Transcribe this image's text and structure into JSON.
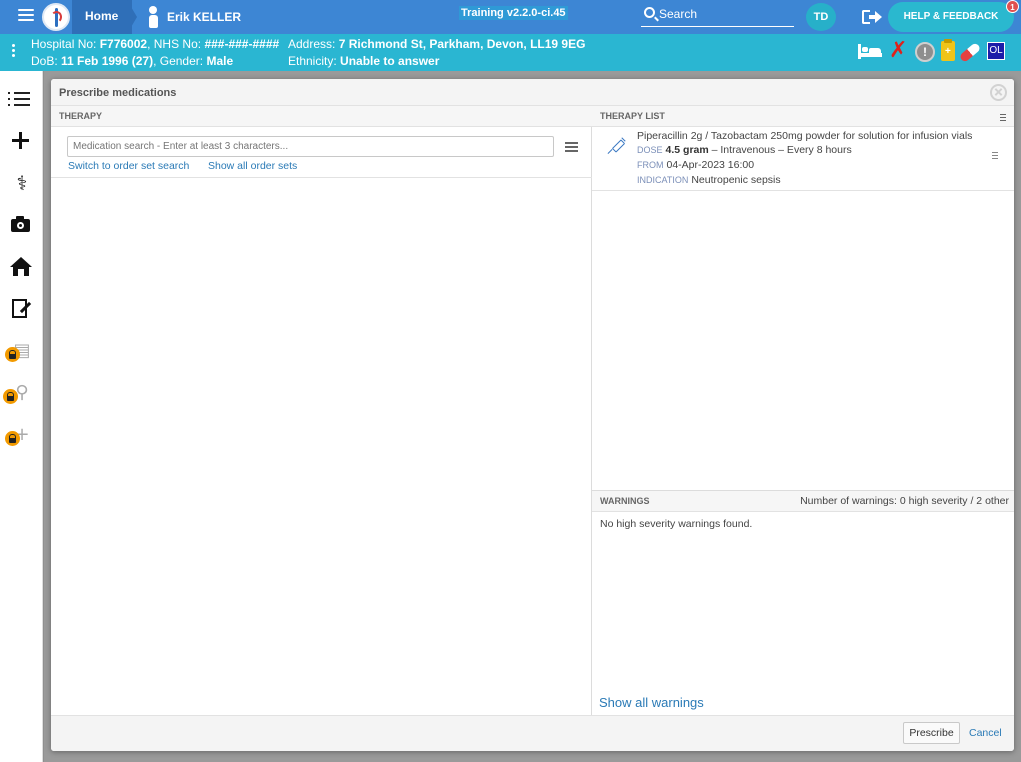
{
  "topbar": {
    "home_label": "Home",
    "patient_name": "Erik KELLER",
    "training_label": "Training v2.2.0-ci.45",
    "search_label": "Search",
    "avatar_initials": "TD",
    "help_label": "HELP & FEEDBACK",
    "help_badge": "1",
    "colors": {
      "bar": "#3d86d4",
      "help": "#2ab8cf"
    }
  },
  "banner": {
    "hospital_prefix": "Hospital No: ",
    "hospital_no": "F776002",
    "nhs_prefix": ", NHS No: ",
    "nhs_no": "###-###-####",
    "dob_prefix": "DoB: ",
    "dob": "11 Feb 1996 (27)",
    "gender_prefix": ", Gender: ",
    "gender": "Male",
    "address_prefix": "Address: ",
    "address": "7 Richmond St, Parkham, Devon, LL19 9EG",
    "ethnicity_prefix": "Ethnicity: ",
    "ethnicity": "Unable to answer",
    "ol_badge": "OL",
    "icons": [
      "bed-icon",
      "x-icon",
      "alert-icon",
      "clipboard-icon",
      "pill-icon",
      "ol-icon"
    ],
    "color": "#2ab6d2"
  },
  "sidebar": {
    "items": [
      {
        "icon": "list-icon",
        "locked": false
      },
      {
        "icon": "plus-icon",
        "locked": false
      },
      {
        "icon": "stethoscope-icon",
        "locked": false
      },
      {
        "icon": "camera-icon",
        "locked": false
      },
      {
        "icon": "home-icon",
        "locked": false
      },
      {
        "icon": "document-edit-icon",
        "locked": false
      },
      {
        "icon": "clipboard-icon",
        "locked": true
      },
      {
        "icon": "walking-icon",
        "locked": true
      },
      {
        "icon": "add-icon",
        "locked": true
      }
    ]
  },
  "modal": {
    "title": "Prescribe medications",
    "therapy_header": "THERAPY",
    "search_placeholder": "Medication search - Enter at least 3 characters...",
    "switch_link": "Switch to order set search",
    "show_all_link": "Show all order sets",
    "therapy_list_header": "THERAPY LIST",
    "therapy": {
      "name": "Piperacillin 2g / Tazobactam 250mg powder for solution for infusion vials",
      "dose_label": "DOSE",
      "dose_value": "4.5 gram",
      "dose_rest": " – Intravenous – Every 8 hours",
      "from_label": "FROM",
      "from_value": "04-Apr-2023 16:00",
      "indication_label": "INDICATION",
      "indication_value": "Neutropenic sepsis"
    },
    "warnings": {
      "header": "WARNINGS",
      "count": "Number of warnings: 0 high severity / 2 other",
      "message": "No high severity warnings found.",
      "show_all": "Show all warnings"
    },
    "prescribe_label": "Prescribe",
    "cancel_label": "Cancel"
  }
}
